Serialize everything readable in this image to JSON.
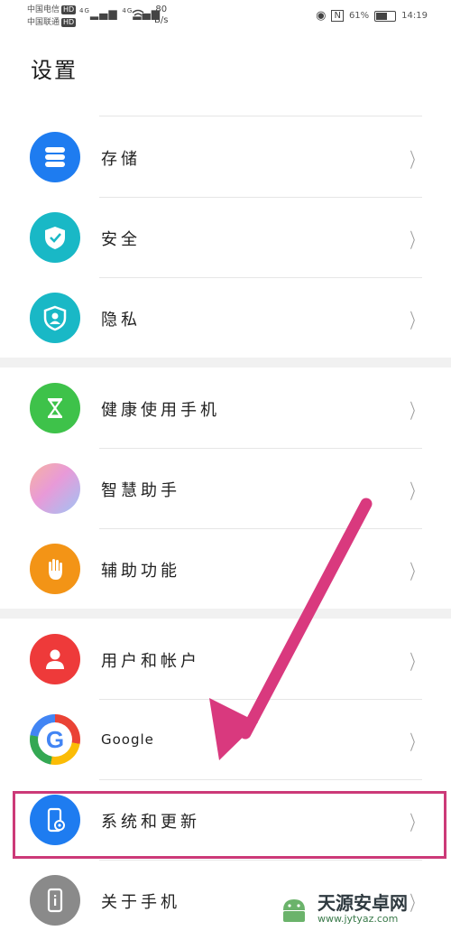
{
  "status_bar": {
    "carrier1": "中国电信",
    "carrier2": "中国联通",
    "hd": "HD",
    "net_label": "4G",
    "speed_value": "80",
    "speed_unit": "B/s",
    "battery_pct": "61%",
    "battery_level": 0.61,
    "time": "14:19"
  },
  "page": {
    "title": "设置"
  },
  "groups": [
    {
      "items": [
        {
          "label": "存储",
          "icon": "storage-icon",
          "color": "#1e7cf0"
        },
        {
          "label": "安全",
          "icon": "shield-check-icon",
          "color": "#19b8c6"
        },
        {
          "label": "隐私",
          "icon": "privacy-person-icon",
          "color": "#19b8c6"
        }
      ]
    },
    {
      "items": [
        {
          "label": "健康使用手机",
          "icon": "hourglass-icon",
          "color": "#3ec24a"
        },
        {
          "label": "智慧助手",
          "icon": "smart-assistant-icon",
          "color": "#e89ad8"
        },
        {
          "label": "辅助功能",
          "icon": "hand-icon",
          "color": "#f39416"
        }
      ]
    },
    {
      "items": [
        {
          "label": "用户和帐户",
          "icon": "user-icon",
          "color": "#ee3a3a"
        },
        {
          "label": "Google",
          "icon": "google-icon",
          "color": "#4285f4"
        },
        {
          "label": "系统和更新",
          "icon": "system-update-icon",
          "color": "#1e7cf0"
        },
        {
          "label": "关于手机",
          "icon": "phone-info-icon",
          "color": "#8a8a8a"
        }
      ]
    }
  ],
  "watermark": {
    "name": "天源安卓网",
    "url": "www.jytyaz.com"
  }
}
